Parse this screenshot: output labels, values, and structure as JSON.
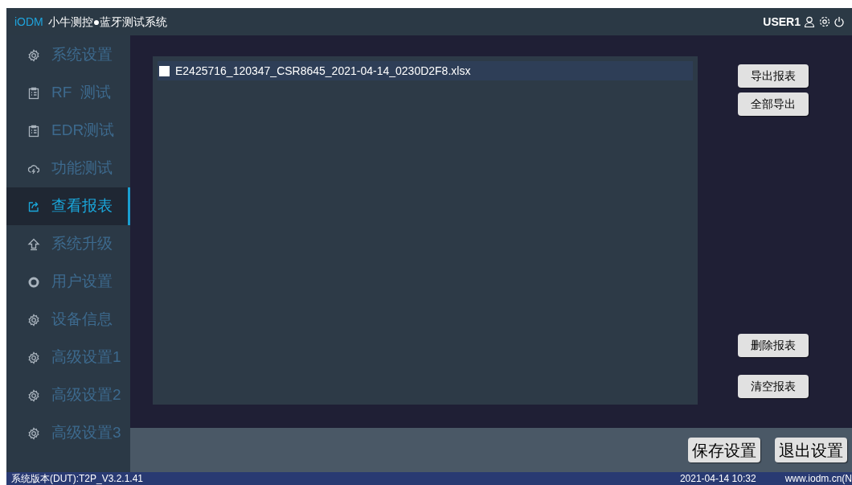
{
  "window": {
    "brand": "iODM",
    "title": "小牛测控●蓝牙测试系统",
    "user": "USER1"
  },
  "sidebar": {
    "items": [
      {
        "label": "系统设置",
        "selected": false
      },
      {
        "label": "RF  测试",
        "selected": false
      },
      {
        "label": "EDR测试",
        "selected": false
      },
      {
        "label": "功能测试",
        "selected": false
      },
      {
        "label": "查看报表",
        "selected": true
      },
      {
        "label": "系统升级",
        "selected": false
      },
      {
        "label": "用户设置",
        "selected": false
      },
      {
        "label": "设备信息",
        "selected": false
      },
      {
        "label": "高级设置1",
        "selected": false
      },
      {
        "label": "高级设置2",
        "selected": false
      },
      {
        "label": "高级设置3",
        "selected": false
      }
    ]
  },
  "files": [
    {
      "name": "E2425716_120347_CSR8645_2021-04-14_0230D2F8.xlsx",
      "checked": false,
      "selected": true
    }
  ],
  "side_buttons": {
    "top": [
      "导出报表",
      "全部导出"
    ],
    "bottom": [
      "删除报表",
      "清空报表"
    ]
  },
  "footer_buttons": [
    "保存设置",
    "退出设置"
  ],
  "status_bar": {
    "version": "系统版本(DUT):T2P_V3.2.1.41",
    "datetime": "2021-04-14 10:32",
    "website": "www.iodm.cn(N"
  }
}
